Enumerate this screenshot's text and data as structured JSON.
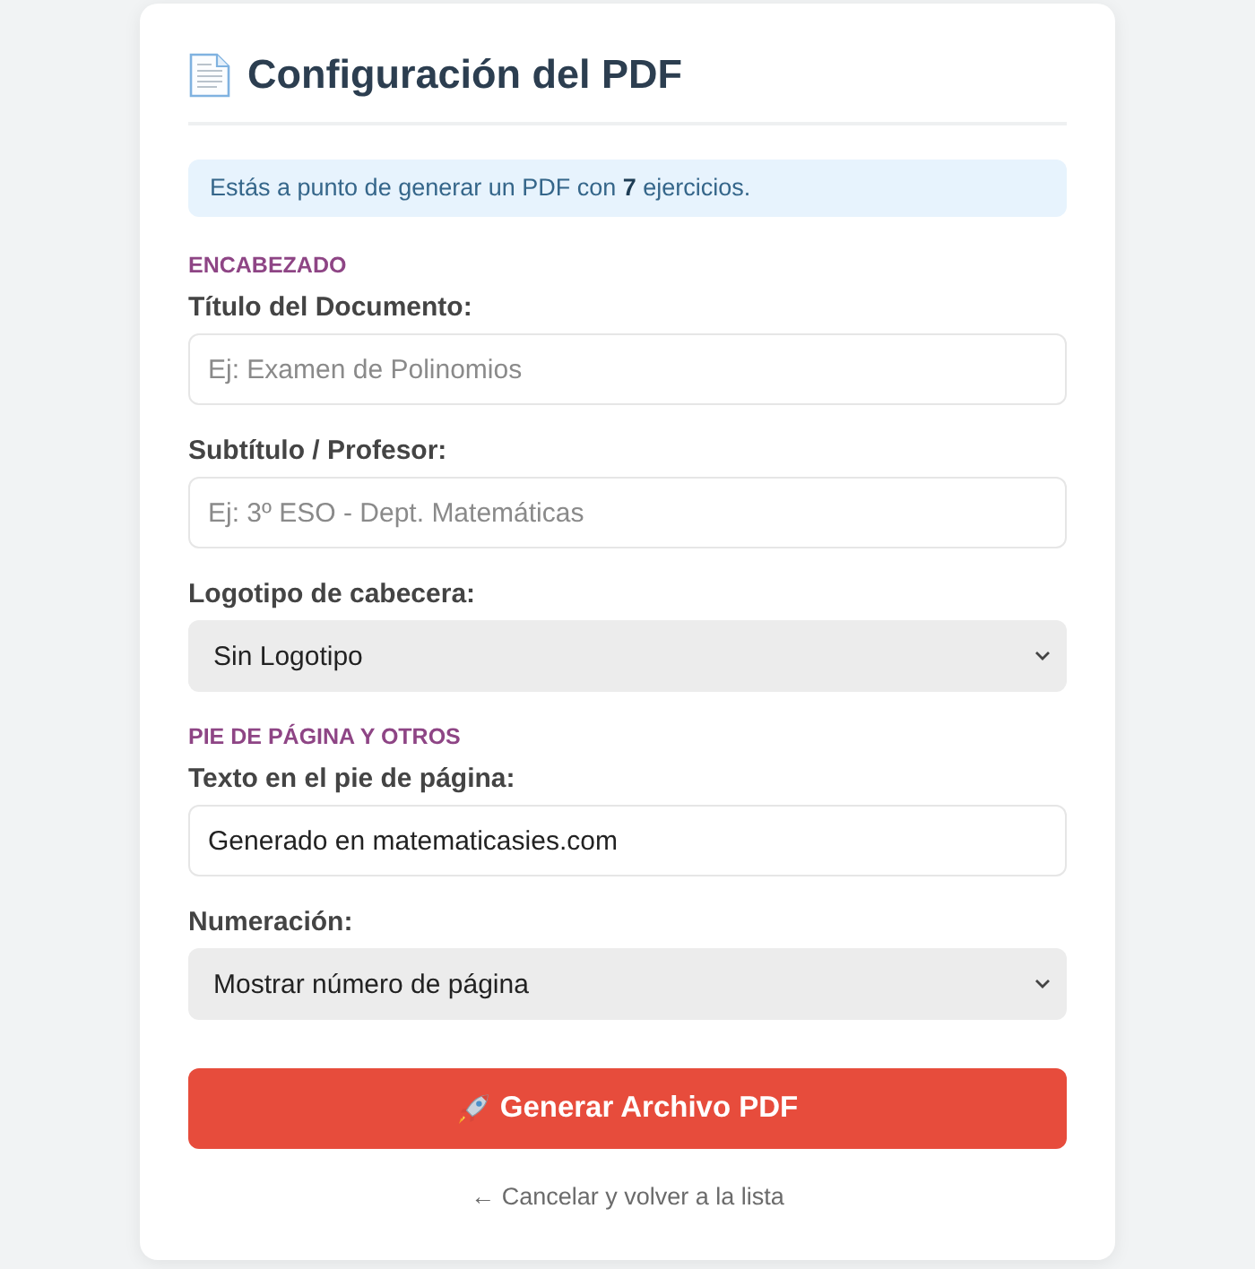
{
  "card": {
    "title": "Configuración del PDF",
    "notice": "Estás a punto de generar un PDF con **7** ejercicios.",
    "sections": [
      {
        "heading": "ENCABEZADO",
        "fields": [
          {
            "kind": "text",
            "label": "Título del Documento:",
            "placeholder": "Ej: Examen de Polinomios"
          },
          {
            "kind": "text",
            "label": "Subtítulo / Profesor:",
            "placeholder": "Ej: 3º ESO - Dept. Matemáticas"
          },
          {
            "kind": "select",
            "label": "Logotipo de cabecera:",
            "value": "Sin Logotipo"
          }
        ]
      },
      {
        "heading": "PIE DE PÁGINA Y OTROS",
        "fields": [
          {
            "kind": "text",
            "label": "Texto en el pie de página:",
            "value": "Generado en matematicasies.com"
          },
          {
            "kind": "select",
            "label": "Numeración:",
            "value": "Mostrar número de página"
          }
        ]
      }
    ],
    "submit_button": "Generar Archivo PDF",
    "cancel_link": "← Cancelar y volver a la lista"
  }
}
